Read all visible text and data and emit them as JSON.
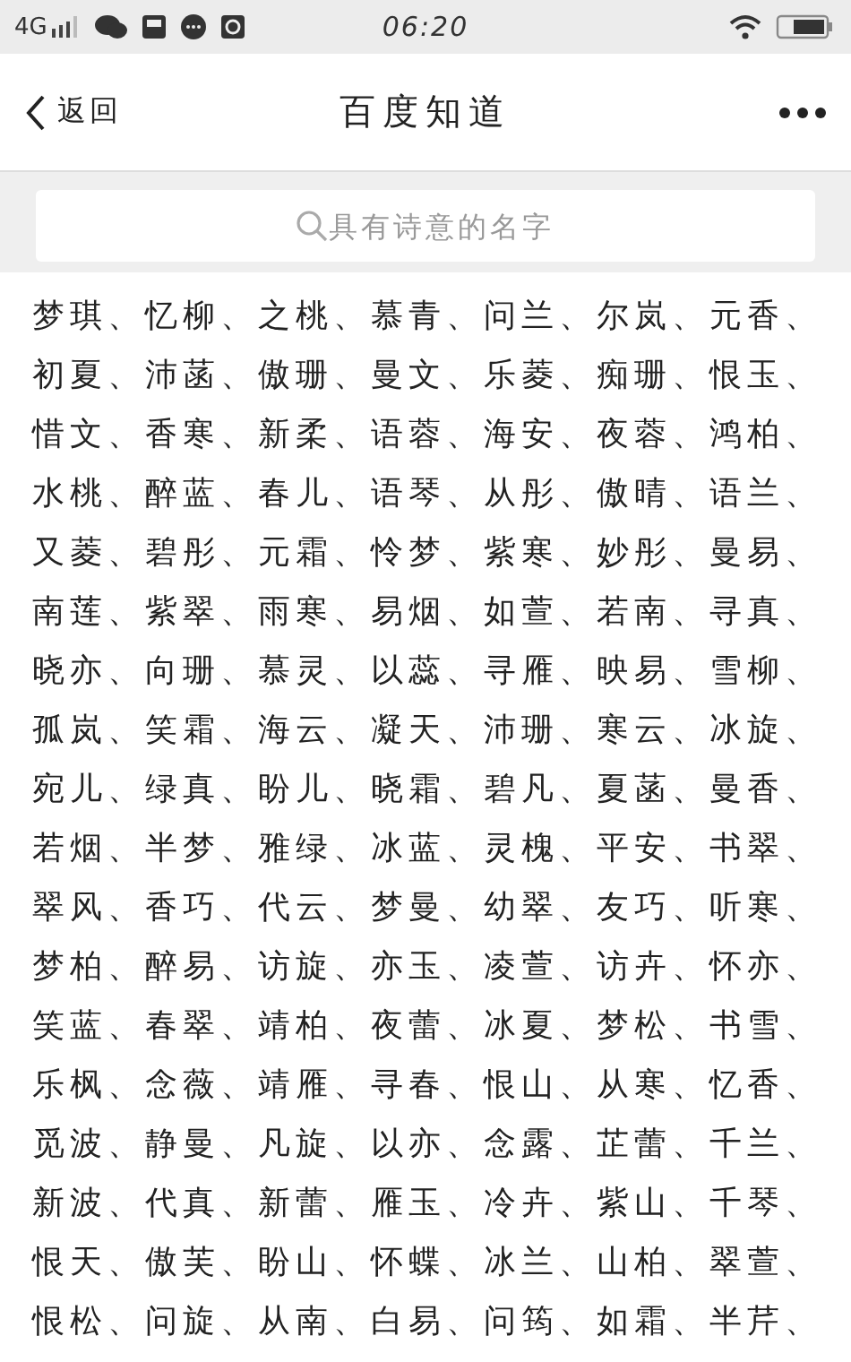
{
  "status_bar": {
    "network": "4G",
    "time": "06:20"
  },
  "nav_bar": {
    "back_label": "返回",
    "title": "百度知道"
  },
  "search": {
    "placeholder": "具有诗意的名字"
  },
  "lines": [
    "梦琪、忆柳、之桃、慕青、问兰、尔岚、元香、",
    "初夏、沛菡、傲珊、曼文、乐菱、痴珊、恨玉、",
    "惜文、香寒、新柔、语蓉、海安、夜蓉、鸿柏、",
    "水桃、醉蓝、春儿、语琴、从彤、傲晴、语兰、",
    "又菱、碧彤、元霜、怜梦、紫寒、妙彤、曼易、",
    "南莲、紫翠、雨寒、易烟、如萱、若南、寻真、",
    "晓亦、向珊、慕灵、以蕊、寻雁、映易、雪柳、",
    "孤岚、笑霜、海云、凝天、沛珊、寒云、冰旋、",
    "宛儿、绿真、盼儿、晓霜、碧凡、夏菡、曼香、",
    "若烟、半梦、雅绿、冰蓝、灵槐、平安、书翠、",
    "翠风、香巧、代云、梦曼、幼翠、友巧、听寒、",
    "梦柏、醉易、访旋、亦玉、凌萱、访卉、怀亦、",
    "笑蓝、春翠、靖柏、夜蕾、冰夏、梦松、书雪、",
    "乐枫、念薇、靖雁、寻春、恨山、从寒、忆香、",
    "觅波、静曼、凡旋、以亦、念露、芷蕾、千兰、",
    "新波、代真、新蕾、雁玉、冷卉、紫山、千琴、",
    "恨天、傲芙、盼山、怀蝶、冰兰、山柏、翠萱、",
    "恨松、问旋、从南、白易、问筠、如霜、半芹、"
  ]
}
